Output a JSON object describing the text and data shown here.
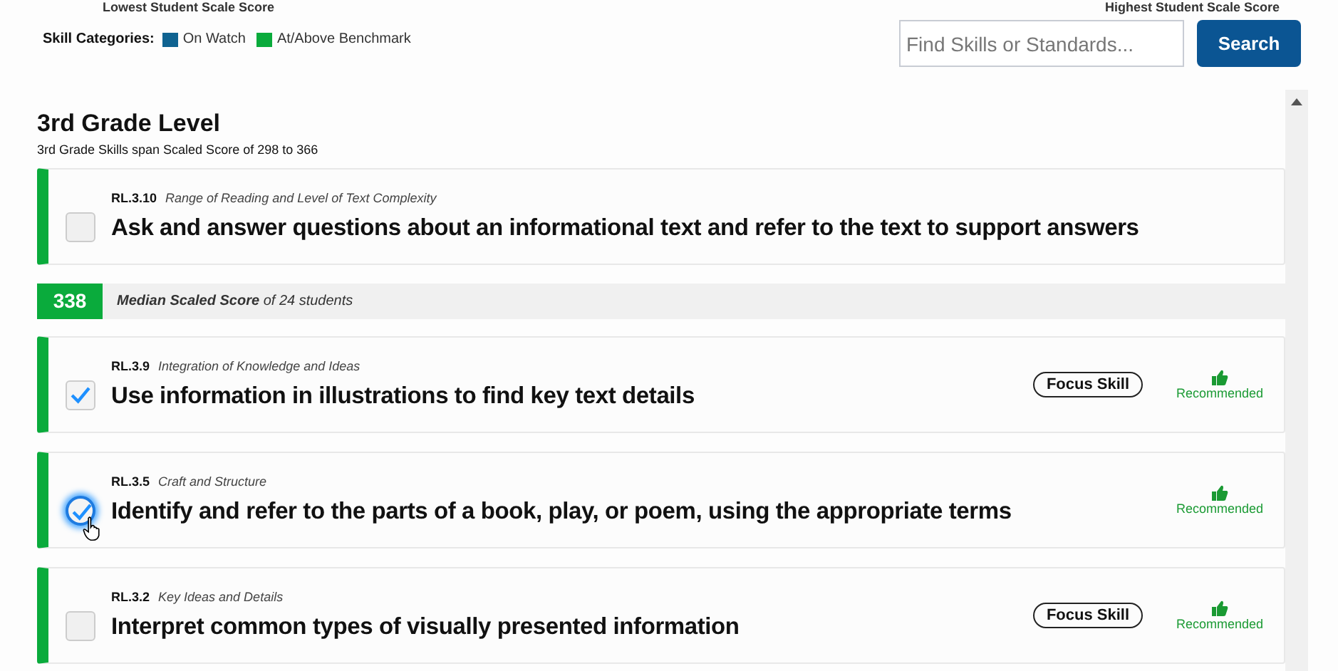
{
  "score_labels": {
    "lowest": "Lowest Student Scale Score",
    "highest": "Highest Student Scale Score"
  },
  "legend": {
    "label": "Skill Categories:",
    "items": [
      {
        "label": "On Watch",
        "color": "#0f6391"
      },
      {
        "label": "At/Above Benchmark",
        "color": "#0aab3c"
      }
    ]
  },
  "search": {
    "placeholder": "Find Skills or Standards...",
    "button": "Search"
  },
  "grade": {
    "title": "3rd Grade Level",
    "subtitle": "3rd Grade Skills span Scaled Score of 298 to 366"
  },
  "items": [
    {
      "kind": "skill",
      "code": "RL.3.10",
      "category": "Range of Reading and Level of Text Complexity",
      "title": "Ask and answer questions about an informational text and refer to the text to support answers",
      "checked": false,
      "focused": false,
      "focus_skill": false,
      "recommended": false,
      "color": "#0aab3c"
    },
    {
      "kind": "median",
      "score": "338",
      "text": "**Median Scaled Score** of 24 students",
      "color": "#0aab3c"
    },
    {
      "kind": "skill",
      "code": "RL.3.9",
      "category": "Integration of Knowledge and Ideas",
      "title": "Use information in illustrations to find key text details",
      "checked": true,
      "focused": false,
      "focus_skill": true,
      "focus_label": "Focus Skill",
      "recommended": true,
      "recommended_label": "Recommended",
      "color": "#0aab3c"
    },
    {
      "kind": "skill",
      "code": "RL.3.5",
      "category": "Craft and Structure",
      "title": "Identify and refer to the parts of a book, play, or poem, using the appropriate terms",
      "checked": true,
      "focused": true,
      "focus_skill": false,
      "recommended": true,
      "recommended_label": "Recommended",
      "color": "#0aab3c"
    },
    {
      "kind": "skill",
      "code": "RL.3.2",
      "category": "Key Ideas and Details",
      "title": "Interpret common types of visually presented information",
      "checked": false,
      "focused": false,
      "focus_skill": true,
      "focus_label": "Focus Skill",
      "recommended": true,
      "recommended_label": "Recommended",
      "color": "#0aab3c"
    }
  ]
}
